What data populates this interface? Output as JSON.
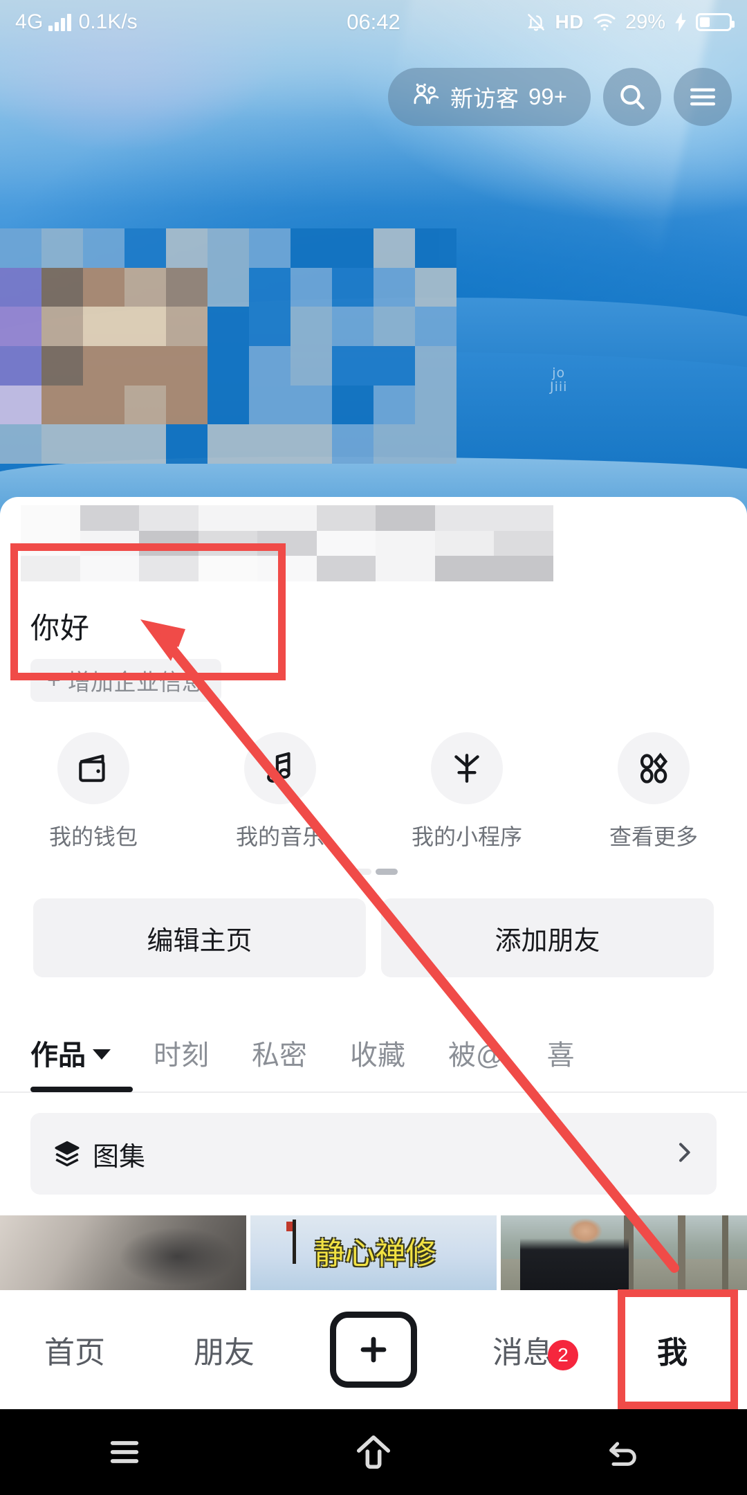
{
  "statusbar": {
    "network": "4G",
    "speed": "0.1K/s",
    "time": "06:42",
    "hd": "HD",
    "battery_percent": "29%",
    "icons": [
      "signal-bars-icon",
      "mute-bell-icon",
      "hd-icon",
      "wifi-icon",
      "charging-bolt-icon",
      "battery-icon"
    ]
  },
  "header": {
    "visitor_label": "新访客",
    "visitor_count": "99+",
    "search_icon": "search-icon",
    "menu_icon": "hamburger-menu-icon"
  },
  "profile": {
    "nickname": "你好",
    "business_button": "增加企业信息",
    "business_plus": "+"
  },
  "quick_actions": [
    {
      "label": "我的钱包",
      "icon": "wallet-icon"
    },
    {
      "label": "我的音乐",
      "icon": "music-note-icon"
    },
    {
      "label": "我的小程序",
      "icon": "mini-program-icon"
    },
    {
      "label": "查看更多",
      "icon": "grid-apps-icon"
    }
  ],
  "buttons": {
    "edit_home": "编辑主页",
    "add_friend": "添加朋友"
  },
  "tabs": [
    {
      "label": "作品",
      "active": true,
      "has_caret": true
    },
    {
      "label": "时刻",
      "active": false
    },
    {
      "label": "私密",
      "active": false
    },
    {
      "label": "收藏",
      "active": false
    },
    {
      "label": "被@",
      "active": false
    },
    {
      "label": "喜",
      "active": false
    }
  ],
  "album": {
    "label": "图集",
    "icon": "layers-stack-icon",
    "chevron": "chevron-right-icon"
  },
  "bottom_nav": [
    {
      "label": "首页",
      "selected": false
    },
    {
      "label": "朋友",
      "selected": false
    },
    {
      "label": "",
      "selected": false,
      "icon": "plus-create-icon"
    },
    {
      "label": "消息",
      "selected": false,
      "badge": "2"
    },
    {
      "label": "我",
      "selected": true
    }
  ],
  "android_nav": [
    {
      "icon": "recents-icon"
    },
    {
      "icon": "home-icon"
    },
    {
      "icon": "back-icon"
    }
  ],
  "video_thumbs": [
    {
      "name": "thumb-waterfall"
    },
    {
      "name": "thumb-calligraphy",
      "text": "静心禅修"
    },
    {
      "name": "thumb-outdoor-man"
    }
  ],
  "annotations": {
    "highlight_nickname": "red-box-around-nickname",
    "highlight_me_tab": "red-box-around-me-tab",
    "arrow": "red-arrow-from-me-tab-to-nickname"
  },
  "colors": {
    "annotation_red": "#f04b48",
    "badge_red": "#f5263d",
    "cover_blue": "#0e72c2",
    "text_primary": "#16181c",
    "text_muted": "#8b8f96",
    "chip_bg": "#f2f2f4"
  },
  "cover": {
    "watermark": "jo\nJiii"
  }
}
